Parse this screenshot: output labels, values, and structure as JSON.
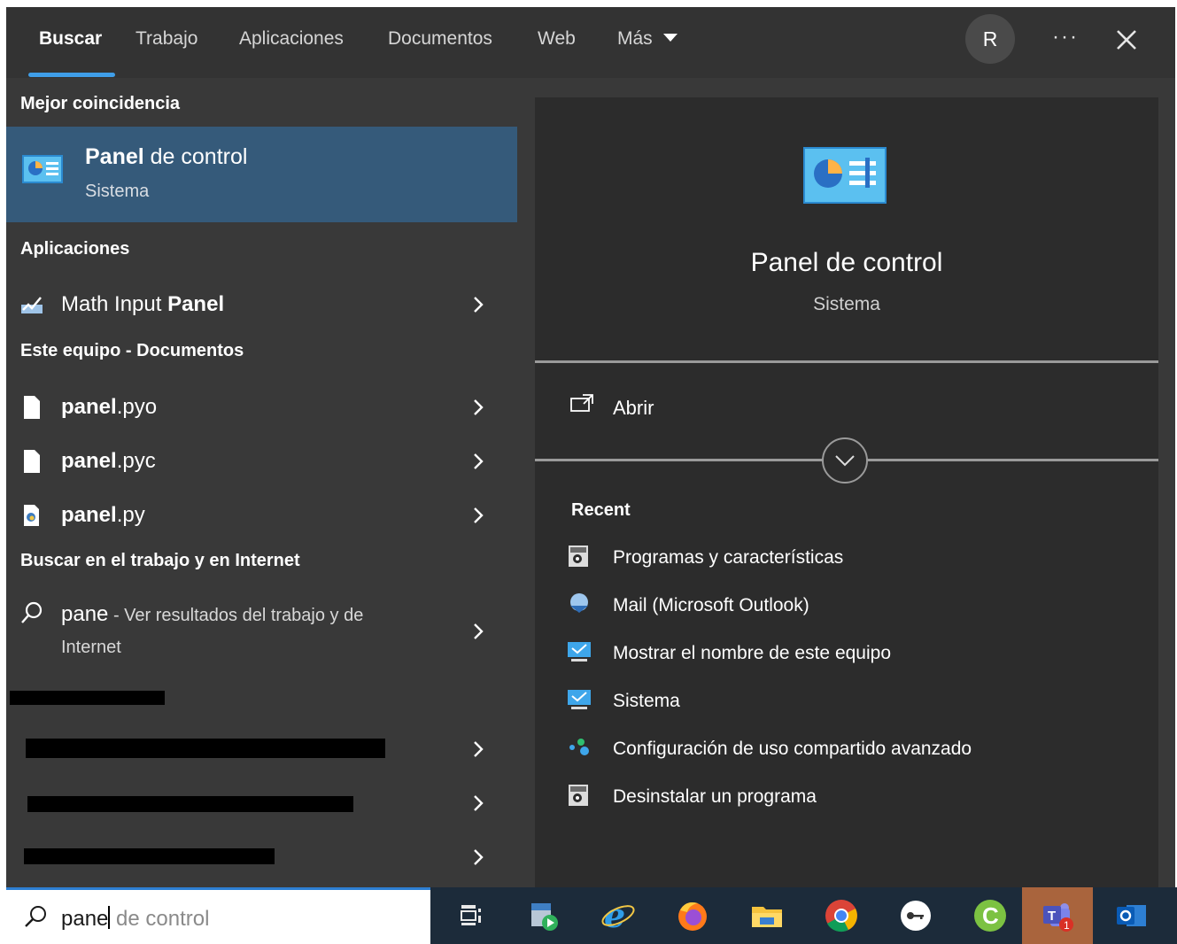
{
  "tabs": [
    {
      "label": "Buscar",
      "active": true
    },
    {
      "label": "Trabajo",
      "active": false
    },
    {
      "label": "Aplicaciones",
      "active": false
    },
    {
      "label": "Documentos",
      "active": false
    },
    {
      "label": "Web",
      "active": false
    },
    {
      "label": "Más",
      "active": false
    }
  ],
  "header": {
    "avatar_initial": "R",
    "more_label": "···"
  },
  "left": {
    "best_match_header": "Mejor coincidencia",
    "best_match": {
      "title_bold": "Panel",
      "title_rest": " de control",
      "subtitle": "Sistema",
      "icon": "control-panel-icon"
    },
    "apps_header": "Aplicaciones",
    "apps": [
      {
        "label_plain": "Math Input ",
        "label_bold": "Panel",
        "icon": "math-input-icon"
      }
    ],
    "docs_header": "Este equipo - Documentos",
    "docs": [
      {
        "label_bold": "panel",
        "label_plain": ".pyo",
        "icon": "file-icon"
      },
      {
        "label_bold": "panel",
        "label_plain": ".pyc",
        "icon": "file-icon"
      },
      {
        "label_bold": "panel",
        "label_plain": ".py",
        "icon": "python-file-icon"
      }
    ],
    "web_header": "Buscar en el trabajo y en Internet",
    "web": {
      "query": "pane",
      "suffix": " - Ver resultados del trabajo y de",
      "suffix2": "Internet"
    }
  },
  "preview": {
    "title": "Panel de control",
    "subtitle": "Sistema",
    "open_label": "Abrir",
    "recent_header": "Recent",
    "recent": [
      {
        "label": "Programas y características",
        "icon": "programs-icon"
      },
      {
        "label": "Mail (Microsoft Outlook)",
        "icon": "mail-icon"
      },
      {
        "label": "Mostrar el nombre de este equipo",
        "icon": "monitor-icon"
      },
      {
        "label": "Sistema",
        "icon": "monitor-icon"
      },
      {
        "label": "Configuración de uso compartido avanzado",
        "icon": "network-icon"
      },
      {
        "label": "Desinstalar un programa",
        "icon": "programs-icon"
      }
    ]
  },
  "search": {
    "typed": "pane",
    "suggestion": " de control"
  },
  "taskbar": [
    "task-view",
    "media-player",
    "internet-explorer",
    "firefox",
    "file-explorer",
    "chrome",
    "keepass",
    "c-app",
    "teams",
    "outlook"
  ],
  "colors": {
    "accent": "#3f9ee8",
    "selected": "#355a7a",
    "panel": "#393939",
    "preview": "#2c2c2c",
    "taskbar": "#1c2b3a"
  }
}
